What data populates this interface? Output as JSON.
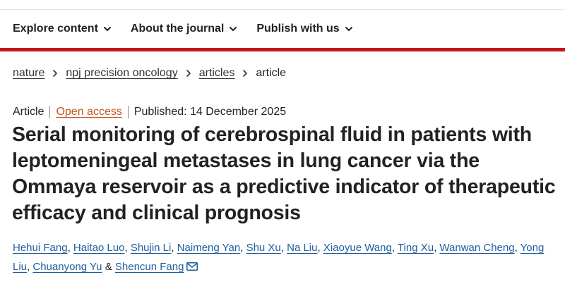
{
  "nav": {
    "items": [
      {
        "label": "Explore content"
      },
      {
        "label": "About the journal"
      },
      {
        "label": "Publish with us"
      }
    ]
  },
  "breadcrumb": {
    "items": [
      "nature",
      "npj precision oncology",
      "articles"
    ],
    "current": "article"
  },
  "article": {
    "type": "Article",
    "access": "Open access",
    "published": "Published: 14 December 2025",
    "title": "Serial monitoring of cerebrospinal fluid in patients with leptomeningeal metastases in lung cancer via the Ommaya reservoir as a predictive indicator of therapeutic efficacy and clinical prognosis"
  },
  "authors": {
    "list": [
      "Hehui Fang",
      "Haitao Luo",
      "Shujin Li",
      "Naimeng Yan",
      "Shu Xu",
      "Na Liu",
      "Xiaoyue Wang",
      "Ting Xu",
      "Wanwan Cheng",
      "Yong Liu",
      "Chuanyong Yu",
      "Shencun Fang"
    ],
    "separator": ", ",
    "final_separator": " & "
  },
  "icons": {
    "nav_chevron": "chevron-down-icon",
    "breadcrumb_separator": "chevron-right-icon",
    "contact": "envelope-icon"
  },
  "colors": {
    "brand_red": "#c5161d",
    "open_access": "#c1571a",
    "author_link": "#1f5d9c"
  }
}
